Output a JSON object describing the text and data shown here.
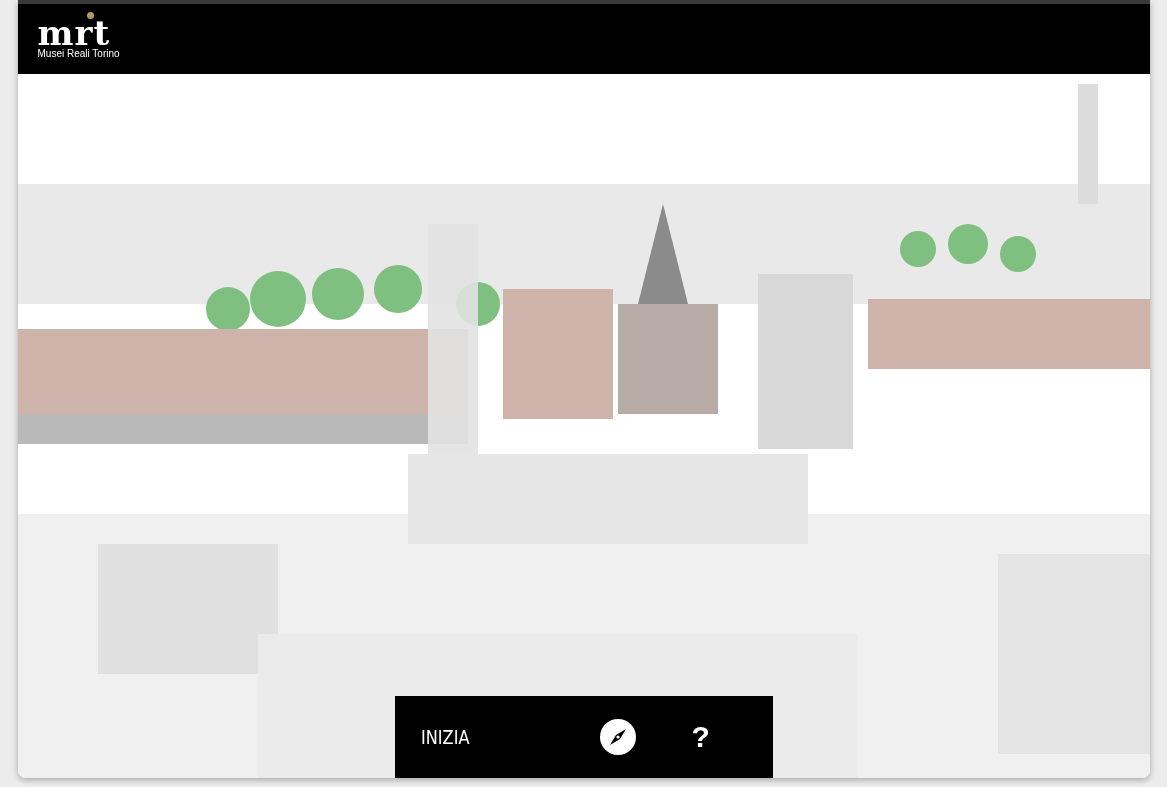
{
  "header": {
    "logo_mark": "mrt",
    "logo_caption": "Musei Reali Torino"
  },
  "toolbar": {
    "start_button": "INIZIA",
    "help_button": "?"
  }
}
